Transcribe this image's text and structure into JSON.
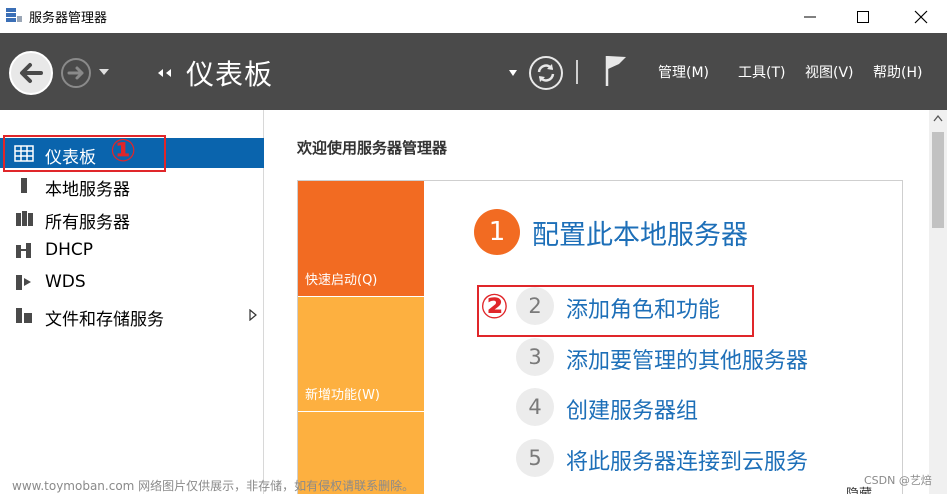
{
  "window": {
    "title": "服务器管理器",
    "minimize_icon": "minimize-icon",
    "maximize_icon": "maximize-icon",
    "close_icon": "close-icon"
  },
  "toolbar": {
    "breadcrumb_title": "仪表板",
    "menus": [
      {
        "label": "管理(M)"
      },
      {
        "label": "工具(T)"
      },
      {
        "label": "视图(V)"
      },
      {
        "label": "帮助(H)"
      }
    ],
    "icons": [
      "back-arrow-icon",
      "forward-arrow-icon",
      "chevron-down-icon",
      "refresh-icon",
      "flag-icon"
    ],
    "background_color": "#4a4a4a"
  },
  "sidebar": {
    "items": [
      {
        "label": "仪表板",
        "icon": "dashboard-icon",
        "selected": true
      },
      {
        "label": "本地服务器",
        "icon": "local-server-icon"
      },
      {
        "label": "所有服务器",
        "icon": "all-servers-icon"
      },
      {
        "label": "DHCP",
        "icon": "dhcp-icon"
      },
      {
        "label": "WDS",
        "icon": "wds-icon"
      },
      {
        "label": "文件和存储服务",
        "icon": "file-storage-icon",
        "expandable": true
      }
    ],
    "selected_color": "#0a64ad"
  },
  "annotations": {
    "marker_1": "①",
    "marker_2": "②",
    "color": "#e0262a"
  },
  "main": {
    "welcome_title": "欢迎使用服务器管理器",
    "tiles": [
      {
        "label": "快速启动(Q)",
        "color": "#f26b22"
      },
      {
        "label": "新增功能(W)",
        "color": "#fdb040"
      },
      {
        "label": "",
        "color": "#fdb040"
      }
    ],
    "step_1": {
      "number": "1",
      "title": "配置此本地服务器"
    },
    "steps": [
      {
        "number": "2",
        "label": "添加角色和功能"
      },
      {
        "number": "3",
        "label": "添加要管理的其他服务器"
      },
      {
        "number": "4",
        "label": "创建服务器组"
      },
      {
        "number": "5",
        "label": "将此服务器连接到云服务"
      }
    ],
    "hide_link": "隐藏",
    "link_color": "#1d6fb8"
  },
  "watermark": "www.toymoban.com 网络图片仅供展示，非存储，如有侵权请联系删除。",
  "credit": "CSDN @艺焙"
}
